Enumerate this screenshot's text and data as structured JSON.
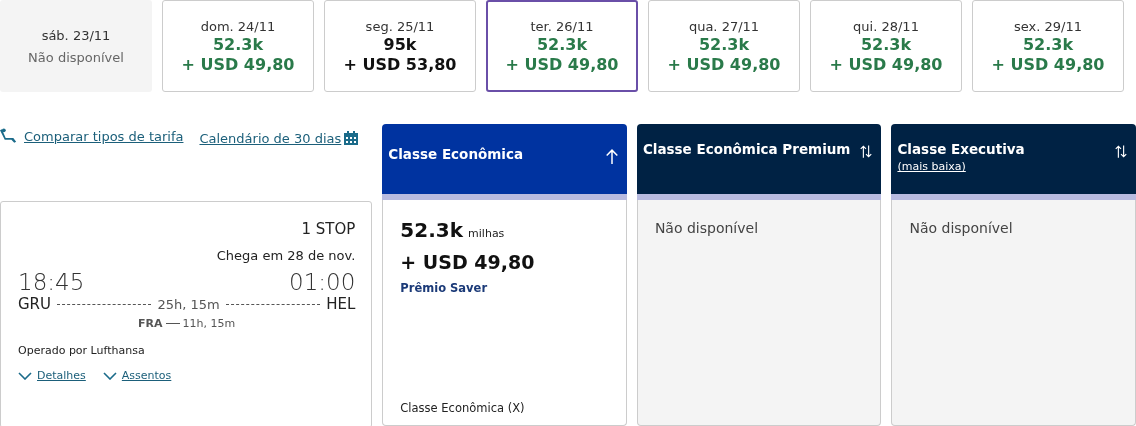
{
  "dates": [
    {
      "kind": "unavailable",
      "date": "sáb. 23/11",
      "note": "Não disponível",
      "selected": false
    },
    {
      "kind": "fare",
      "date": "dom. 24/11",
      "miles": "52.3k",
      "price": "+ USD 49,80",
      "lowest": true,
      "selected": false
    },
    {
      "kind": "fare",
      "date": "seg. 25/11",
      "miles": "95k",
      "price": "+ USD 53,80",
      "lowest": false,
      "selected": false
    },
    {
      "kind": "fare",
      "date": "ter. 26/11",
      "miles": "52.3k",
      "price": "+ USD 49,80",
      "lowest": true,
      "selected": true
    },
    {
      "kind": "fare",
      "date": "qua. 27/11",
      "miles": "52.3k",
      "price": "+ USD 49,80",
      "lowest": true,
      "selected": false
    },
    {
      "kind": "fare",
      "date": "qui. 28/11",
      "miles": "52.3k",
      "price": "+ USD 49,80",
      "lowest": true,
      "selected": false
    },
    {
      "kind": "fare",
      "date": "sex. 29/11",
      "miles": "52.3k",
      "price": "+ USD 49,80",
      "lowest": true,
      "selected": false
    }
  ],
  "links": {
    "compare": "Comparar tipos de tarifa",
    "calendar": "Calendário de 30 dias"
  },
  "flight": {
    "stops": "1 STOP",
    "arrival_note": "Chega em 28 de nov.",
    "depart_time": "18:45",
    "arrive_time": "01:00",
    "origin": "GRU",
    "destination": "HEL",
    "duration": "25h, 15m",
    "layover_airport": "FRA",
    "layover_duration": "11h, 15m",
    "operator": "Operado por Lufthansa",
    "details_link": "Detalhes",
    "seats_link": "Assentos"
  },
  "fare_columns": [
    {
      "title": "Classe Econômica",
      "sorted": true,
      "selected": true,
      "kind": "fare",
      "miles": "52.3k",
      "miles_unit": "milhas",
      "price": "+ USD 49,80",
      "award": "Prêmio Saver",
      "cabin": "Classe Econômica (X)"
    },
    {
      "title": "Classe Econômica Premium",
      "sorted": false,
      "selected": false,
      "kind": "unavailable",
      "note": "Não disponível"
    },
    {
      "title": "Classe Executiva",
      "subtitle_link": "(mais baixa)",
      "sorted": false,
      "selected": false,
      "kind": "unavailable",
      "note": "Não disponível"
    }
  ]
}
